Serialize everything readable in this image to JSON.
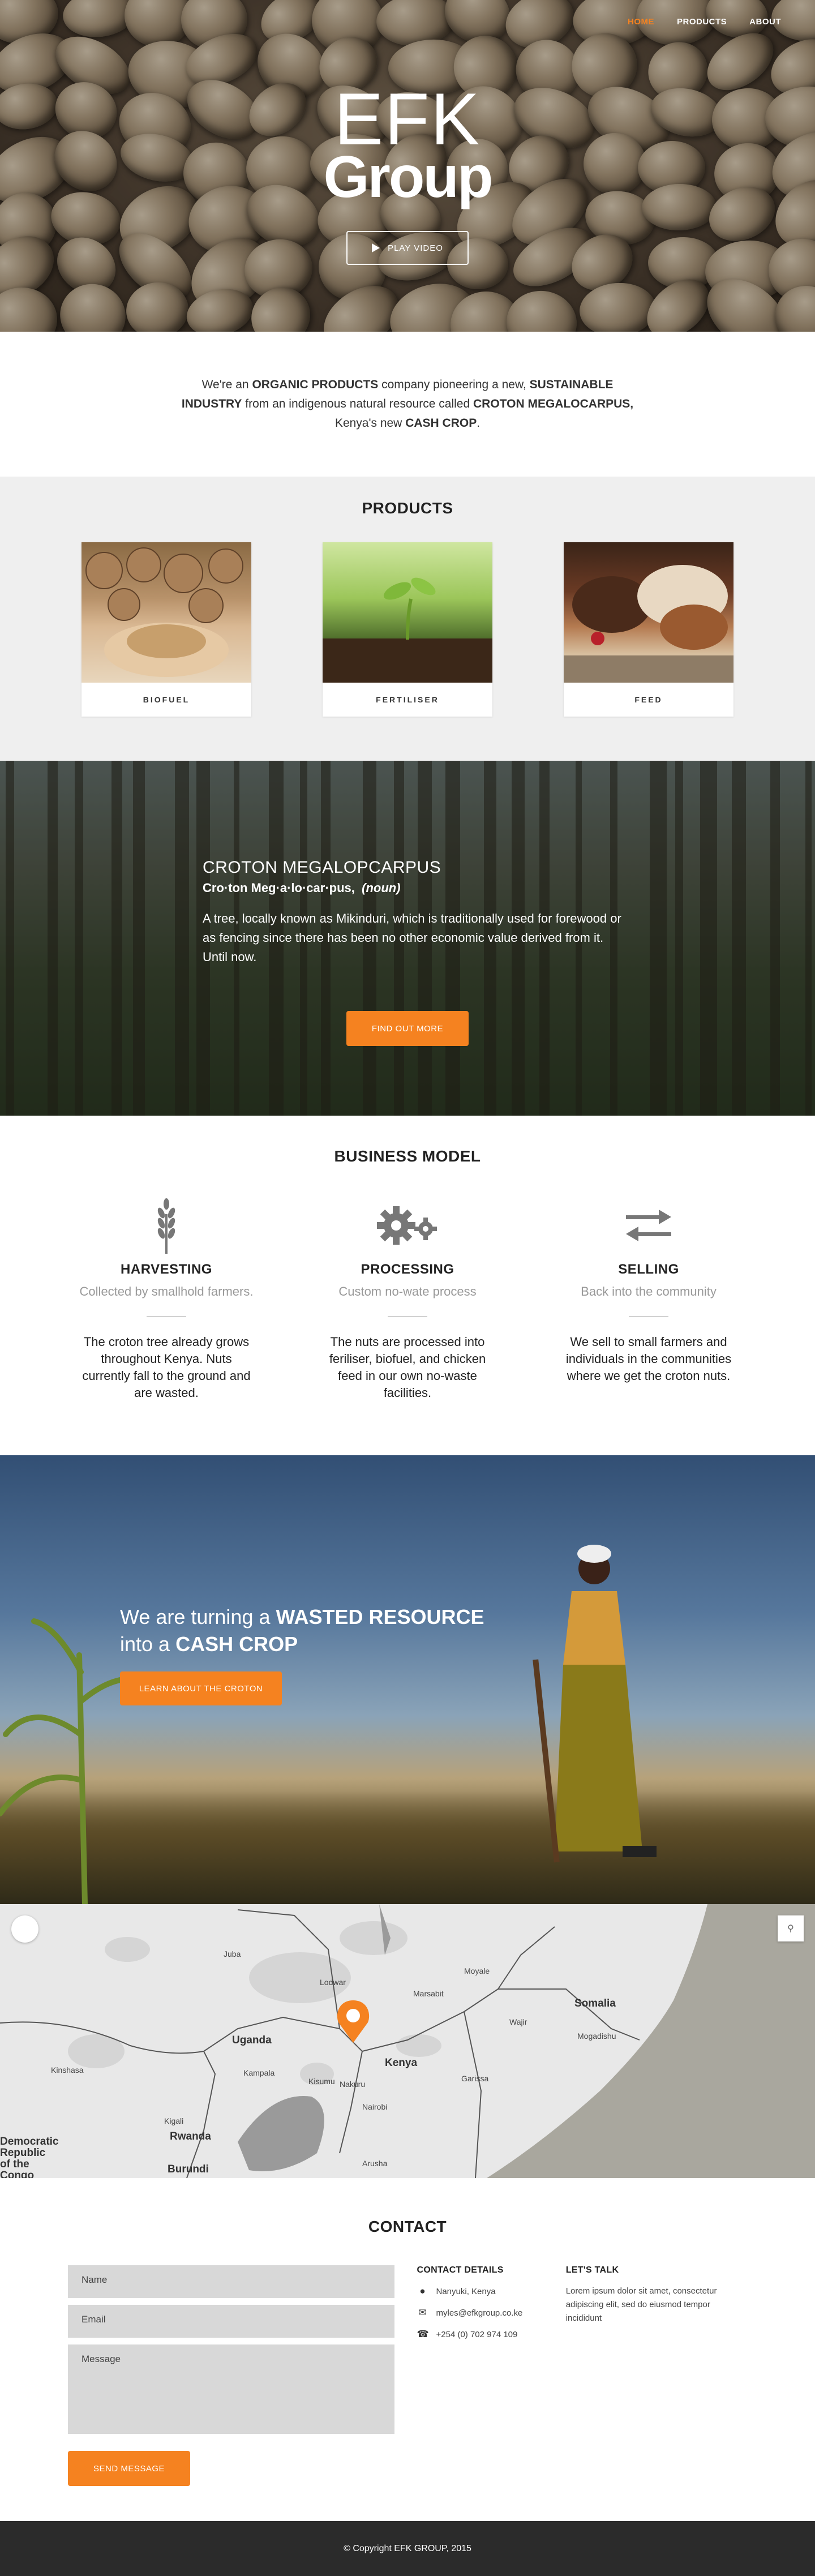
{
  "nav": {
    "items": [
      {
        "label": "HOME",
        "active": true
      },
      {
        "label": "PRODUCTS",
        "active": false
      },
      {
        "label": "ABOUT",
        "active": false
      }
    ]
  },
  "hero": {
    "logo_line1": "EFK",
    "logo_line2": "Group",
    "play_label": "PLAY VIDEO"
  },
  "intro": {
    "t1": "We're an ",
    "b1": "ORGANIC PRODUCTS",
    "t2": " company pioneering a new, ",
    "b2": "SUSTAINABLE INDUSTRY",
    "t3": " from an indigenous natural resource called ",
    "b3": "CROTON MEGALOCARPUS,",
    "t4": " Kenya's new ",
    "b4": "CASH CROP",
    "t5": "."
  },
  "products": {
    "title": "PRODUCTS",
    "items": [
      {
        "label": "BIOFUEL"
      },
      {
        "label": "FERTILISER"
      },
      {
        "label": "FEED"
      }
    ]
  },
  "croton": {
    "title": "CROTON MEGALOPCARPUS",
    "pron": "Cro·ton Meg·a·lo·car·pus,",
    "pos": "(noun)",
    "desc": "A tree, locally known as Mikinduri, which is traditionally used for forewood or as fencing since there has been no other economic value derived from it. Until now.",
    "button": "FIND OUT MORE"
  },
  "business": {
    "title": "BUSINESS MODEL",
    "items": [
      {
        "icon": "wheat-icon",
        "title": "HARVESTING",
        "sub": "Collected by smallhold farmers.",
        "desc": "The croton tree already grows throughout Kenya. Nuts currently fall to the ground and are wasted."
      },
      {
        "icon": "gears-icon",
        "title": "PROCESSING",
        "sub": "Custom no-wate process",
        "desc": "The nuts are processed into feriliser, biofuel, and chicken feed in our own no-waste facilities."
      },
      {
        "icon": "exchange-arrows-icon",
        "title": "SELLING",
        "sub": "Back into the community",
        "desc": "We sell to small farmers and individuals in the communities where we get the croton nuts."
      }
    ]
  },
  "wasted": {
    "t1": "We are turning a ",
    "b1": "WASTED RESOURCE",
    "t2": "into a ",
    "b2": "CASH CROP",
    "button": "LEARN ABOUT THE CROTON"
  },
  "map": {
    "labels": [
      "Somalia",
      "Uganda",
      "Kenya",
      "Rwanda",
      "Burundi",
      "Democratic Republic of the Congo",
      "Kampala",
      "Nairobi",
      "Mogadishu",
      "Juba",
      "Kisumu",
      "Nakuru",
      "Garissa",
      "Kigali",
      "Marsabit",
      "Lodwar",
      "Moyale",
      "Wajir",
      "Arusha",
      "Kinshasa"
    ]
  },
  "contact": {
    "title": "CONTACT",
    "name_placeholder": "Name",
    "email_placeholder": "Email",
    "message_placeholder": "Message",
    "send": "SEND MESSAGE",
    "details_title": "CONTACT DETAILS",
    "location": "Nanyuki, Kenya",
    "email": "myles@efkgroup.co.ke",
    "phone": "+254 (0) 702 974 109",
    "talk_title": "LET'S TALK",
    "talk_text": "Lorem ipsum dolor sit amet, consectetur adipiscing elit, sed do eiusmod tempor incididunt"
  },
  "footer": {
    "copyright": "© Copyright EFK GROUP, 2015"
  },
  "colors": {
    "accent": "#f58220",
    "footer_bg": "#2b2b2b",
    "products_bg": "#efefef"
  }
}
